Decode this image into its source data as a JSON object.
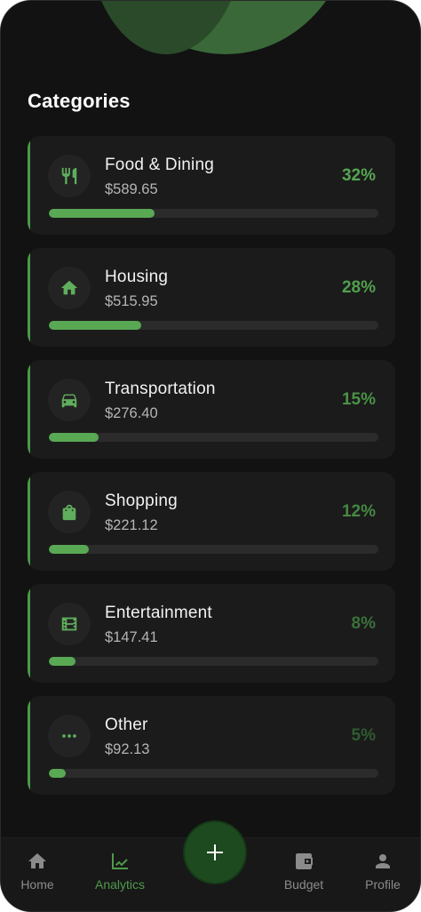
{
  "section_title": "Categories",
  "colors": {
    "accent": "#4a9a4a",
    "progress": "#58a854",
    "track": "#2b2b2b",
    "card": "#1b1b1b",
    "background": "#121212"
  },
  "categories": [
    {
      "name": "Food & Dining",
      "amount": "$589.65",
      "percent_label": "32%",
      "percent": 32,
      "icon": "utensils-icon",
      "percent_color": "#55a651"
    },
    {
      "name": "Housing",
      "amount": "$515.95",
      "percent_label": "28%",
      "percent": 28,
      "icon": "home-icon",
      "percent_color": "#50a04d"
    },
    {
      "name": "Transportation",
      "amount": "$276.40",
      "percent_label": "15%",
      "percent": 15,
      "icon": "car-icon",
      "percent_color": "#4a9347"
    },
    {
      "name": "Shopping",
      "amount": "$221.12",
      "percent_label": "12%",
      "percent": 12,
      "icon": "shopping-bag-icon",
      "percent_color": "#448842"
    },
    {
      "name": "Entertainment",
      "amount": "$147.41",
      "percent_label": "8%",
      "percent": 8,
      "icon": "film-icon",
      "percent_color": "#3a713a"
    },
    {
      "name": "Other",
      "amount": "$92.13",
      "percent_label": "5%",
      "percent": 5,
      "icon": "more-dots-icon",
      "percent_color": "#2f5c30"
    }
  ],
  "nav": {
    "home": "Home",
    "analytics": "Analytics",
    "budget": "Budget",
    "profile": "Profile",
    "active": "analytics"
  },
  "fab_icon": "plus-icon"
}
